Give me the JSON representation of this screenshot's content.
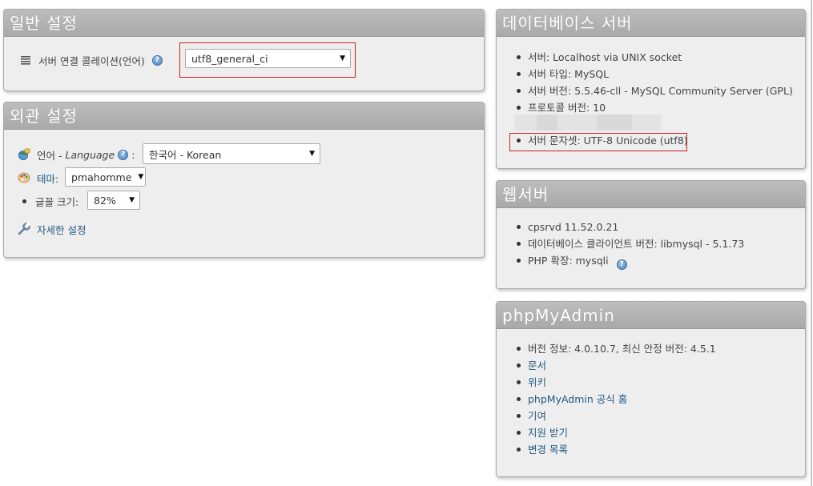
{
  "general": {
    "title": "일반 설정",
    "collation_label": "서버 연결 콜레이션(언어)",
    "collation_help": "?",
    "collation_value": "utf8_general_ci"
  },
  "appearance": {
    "title": "외관 설정",
    "language_label": "언어 - ",
    "language_english": "Language",
    "language_colon": ":",
    "language_value": "한국어 - Korean",
    "theme_label": "테마:",
    "theme_value": "pmahomme",
    "fontsize_label": "글꼴 크기:",
    "fontsize_value": "82%",
    "more_settings_label": "자세한 설정"
  },
  "dbserver": {
    "title": "데이터베이스 서버",
    "items": [
      "서버: Localhost via UNIX socket",
      "서버 타입: MySQL",
      "서버 버전: 5.5.46-cll - MySQL Community Server (GPL)",
      "프로토콜 버전: 10"
    ],
    "charset": "서버 문자셋: UTF-8 Unicode (utf8)"
  },
  "webserver": {
    "title": "웹서버",
    "items": [
      "cpsrvd 11.52.0.21",
      "데이터베이스 클라이언트 버전: libmysql - 5.1.73",
      "PHP 확장: mysqli"
    ]
  },
  "pma": {
    "title": "phpMyAdmin",
    "version": "버전 정보: 4.0.10.7, 최신 안정 버전: 4.5.1",
    "links": [
      "문서",
      "위키",
      "phpMyAdmin 공식 홈",
      "기여",
      "지원 받기",
      "변경 목록"
    ]
  },
  "colors": {
    "panel_bg": "#eeeeee",
    "header_bg": "#adadad",
    "link": "#235a81",
    "highlight": "#cc1f1f"
  },
  "icons": {
    "collation": "list-icon",
    "language": "globe-icon",
    "theme": "palette-icon",
    "more_settings": "wrench-icon",
    "help": "help-icon"
  }
}
